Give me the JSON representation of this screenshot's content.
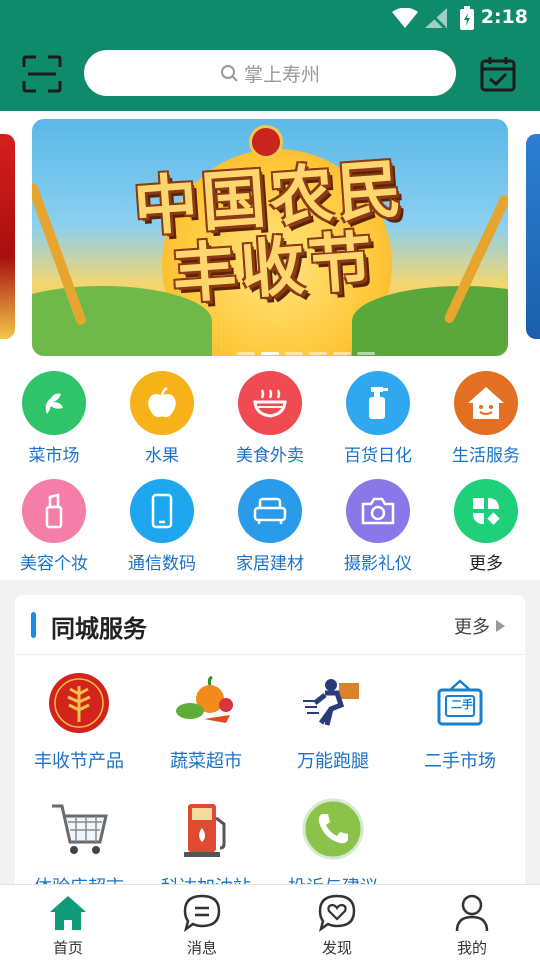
{
  "status_bar": {
    "time": "2:18"
  },
  "header": {
    "search_placeholder": "掌上寿州"
  },
  "banner": {
    "title_line1": "中国农民",
    "title_line2": "丰收节",
    "dot_count": 6,
    "active_dot": 1
  },
  "categories": [
    {
      "label": "菜市场",
      "color": "#2fc46a",
      "icon": "vegetable-icon"
    },
    {
      "label": "水果",
      "color": "#f7b21a",
      "icon": "apple-icon"
    },
    {
      "label": "美食外卖",
      "color": "#f04a52",
      "icon": "bowl-icon"
    },
    {
      "label": "百货日化",
      "color": "#2fa8f0",
      "icon": "bottle-icon"
    },
    {
      "label": "生活服务",
      "color": "#f07b2a",
      "icon": "house-icon"
    },
    {
      "label": "美容个妆",
      "color": "#f57ea8",
      "icon": "lipstick-icon"
    },
    {
      "label": "通信数码",
      "color": "#1ea7ef",
      "icon": "phone-icon"
    },
    {
      "label": "家居建材",
      "color": "#2a9be8",
      "icon": "sofa-icon"
    },
    {
      "label": "摄影礼仪",
      "color": "#8a78e8",
      "icon": "camera-icon"
    },
    {
      "label": "更多",
      "color": "#1fcf7a",
      "icon": "grid-icon"
    }
  ],
  "services": {
    "title": "同城服务",
    "more": "更多",
    "items": [
      {
        "label": "丰收节产品",
        "icon": "harvest-emblem-icon"
      },
      {
        "label": "蔬菜超市",
        "icon": "vegetables-icon"
      },
      {
        "label": "万能跑腿",
        "icon": "courier-icon"
      },
      {
        "label": "二手市场",
        "icon": "second-hand-sign-icon"
      },
      {
        "label": "体验店超市",
        "icon": "cart-icon"
      },
      {
        "label": "科达加油站",
        "icon": "fuel-pump-icon"
      },
      {
        "label": "投诉与建议",
        "icon": "phone-call-icon"
      }
    ],
    "second_hand_sign": "二手"
  },
  "nav": [
    {
      "label": "首页",
      "icon": "home-icon",
      "active": true
    },
    {
      "label": "消息",
      "icon": "message-icon",
      "active": false
    },
    {
      "label": "发现",
      "icon": "discover-icon",
      "active": false
    },
    {
      "label": "我的",
      "icon": "profile-icon",
      "active": false
    }
  ],
  "colors": {
    "header": "#0f8a6b",
    "accent_blue": "#1a72c9",
    "nav_active": "#0f8a6b"
  }
}
